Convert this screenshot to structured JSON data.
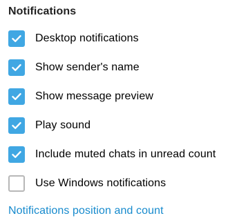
{
  "section": {
    "title": "Notifications"
  },
  "options": [
    {
      "label": "Desktop notifications",
      "checked": true
    },
    {
      "label": "Show sender's name",
      "checked": true
    },
    {
      "label": "Show message preview",
      "checked": true
    },
    {
      "label": "Play sound",
      "checked": true
    },
    {
      "label": "Include muted chats in unread count",
      "checked": true
    },
    {
      "label": "Use Windows notifications",
      "checked": false
    }
  ],
  "link": {
    "label": "Notifications position and count"
  },
  "colors": {
    "accent": "#40a7e3",
    "link": "#168acd",
    "unchecked_border": "#b7b7b7"
  },
  "icons": {
    "checked": "checkmark-icon"
  }
}
